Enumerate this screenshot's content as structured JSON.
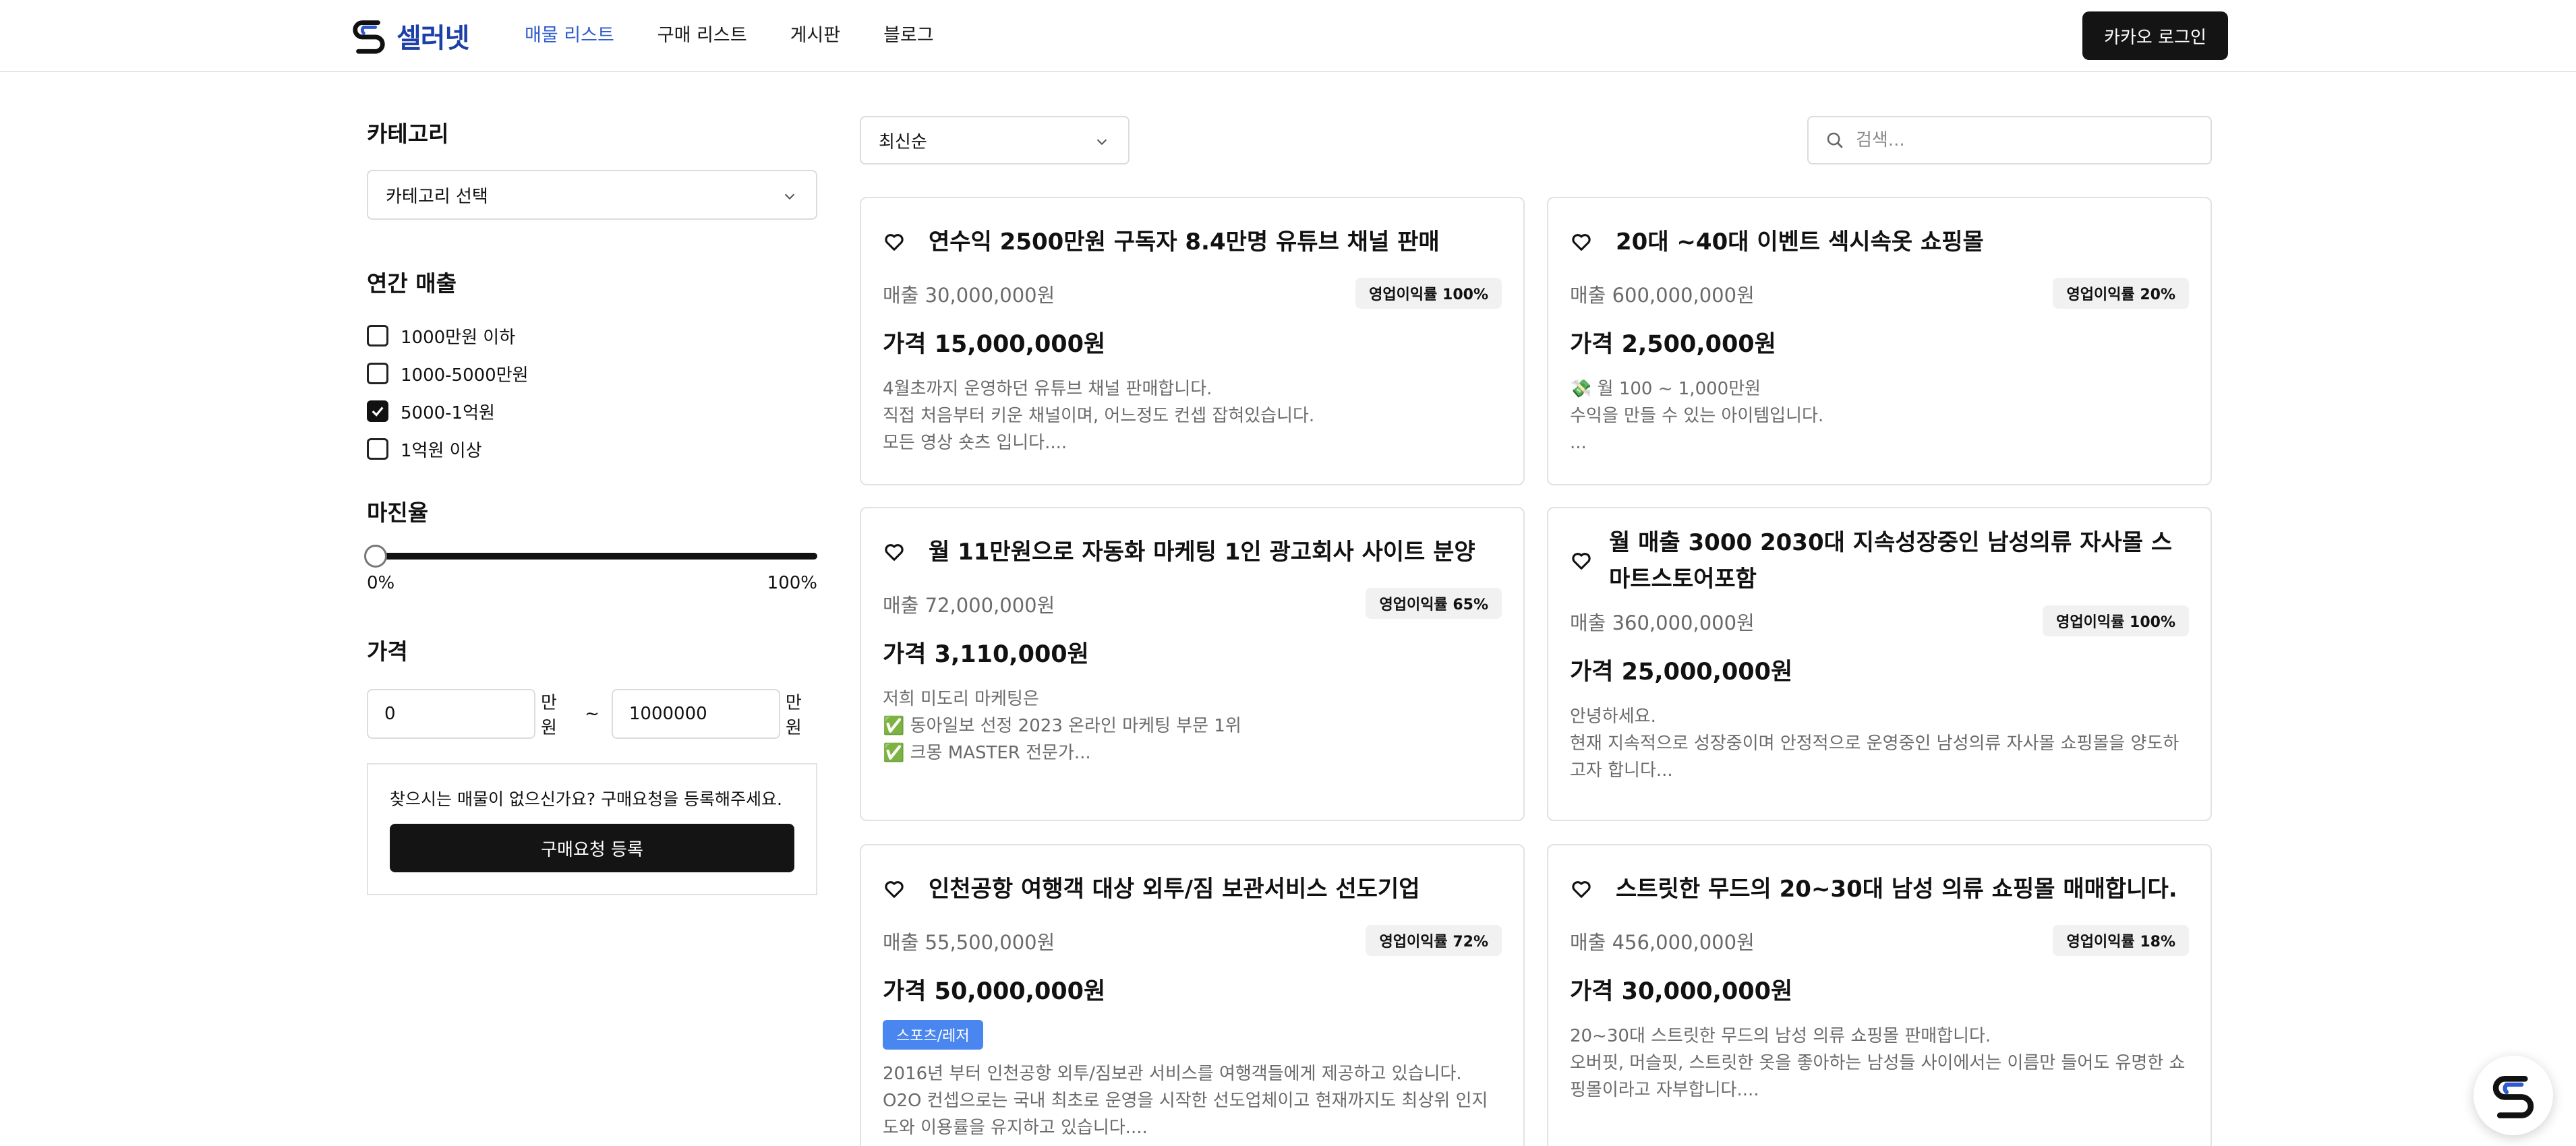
{
  "brand": {
    "name": "셀러넷"
  },
  "nav": [
    "매물 리스트",
    "구매 리스트",
    "게시판",
    "블로그"
  ],
  "login_label": "카카오 로그인",
  "sidebar": {
    "category_title": "카테고리",
    "category_select": "카테고리 선택",
    "revenue_title": "연간 매출",
    "revenue_options": [
      {
        "label": "1000만원 이하",
        "checked": false
      },
      {
        "label": "1000-5000만원",
        "checked": false
      },
      {
        "label": "5000-1억원",
        "checked": true
      },
      {
        "label": "1억원 이상",
        "checked": false
      }
    ],
    "margin_title": "마진율",
    "margin_min": "0%",
    "margin_max": "100%",
    "margin_value_percent": 0,
    "price_title": "가격",
    "price_from": "0",
    "price_to": "1000000",
    "price_unit": "만원",
    "price_sep": "~",
    "request_text": "찾으시는 매물이 없으신가요? 구매요청을 등록해주세요.",
    "request_button": "구매요청 등록"
  },
  "main": {
    "sort_label": "최신순",
    "search_placeholder": "검색...",
    "listings": [
      {
        "title": "연수익 2500만원 구독자 8.4만명 유튜브 채널 판매",
        "sales": "매출 30,000,000원",
        "margin": "영업이익률 100%",
        "price": "가격 15,000,000원",
        "tag": "",
        "desc": [
          "4월초까지 운영하던 유튜브 채널 판매합니다.",
          "직접 처음부터 키운 채널이며, 어느정도 컨셉 잡혀있습니다.",
          "모든 영상 숏츠 입니다...."
        ]
      },
      {
        "title": "20대 ~40대 이벤트 섹시속옷 쇼핑몰",
        "sales": "매출 600,000,000원",
        "margin": "영업이익률 20%",
        "price": "가격 2,500,000원",
        "tag": "",
        "desc": [
          "💸 월 100 ~ 1,000만원",
          "수익을 만들 수 있는 아이템입니다.",
          "..."
        ]
      },
      {
        "title": "월 11만원으로 자동화 마케팅 1인 광고회사 사이트 분양",
        "sales": "매출 72,000,000원",
        "margin": "영업이익률 65%",
        "price": "가격 3,110,000원",
        "tag": "",
        "desc": [
          "저희 미도리 마케팅은",
          "✅ 동아일보 선정 2023 온라인 마케팅 부문 1위",
          "✅ 크몽 MASTER 전문가..."
        ]
      },
      {
        "title": "월 매출 3000 2030대 지속성장중인 남성의류 자사몰 스마트스토어포함",
        "sales": "매출 360,000,000원",
        "margin": "영업이익률 100%",
        "price": "가격 25,000,000원",
        "tag": "",
        "desc": [
          "안녕하세요.",
          "현재 지속적으로 성장중이며 안정적으로 운영중인 남성의류 자사몰 쇼핑몰을 양도하고자 합니다..."
        ]
      },
      {
        "title": "인천공항 여행객 대상 외투/짐 보관서비스 선도기업",
        "sales": "매출 55,500,000원",
        "margin": "영업이익률 72%",
        "price": "가격 50,000,000원",
        "tag": "스포츠/레저",
        "desc": [
          "2016년 부터 인천공항 외투/짐보관 서비스를 여행객들에게 제공하고 있습니다.",
          "O2O 컨셉으로는 국내 최초로 운영을 시작한 선도업체이고 현재까지도 최상위 인지도와 이용률을 유지하고 있습니다...."
        ]
      },
      {
        "title": "스트릿한 무드의 20~30대 남성 의류 쇼핑몰 매매합니다.",
        "sales": "매출 456,000,000원",
        "margin": "영업이익률 18%",
        "price": "가격 30,000,000원",
        "tag": "",
        "desc": [
          "20~30대 스트릿한 무드의 남성 의류 쇼핑몰 판매합니다.",
          "오버핏, 머슬핏, 스트릿한 옷을 좋아하는 남성들 사이에서는 이름만 들어도 유명한 쇼핑몰이라고 자부합니다...."
        ]
      }
    ]
  }
}
